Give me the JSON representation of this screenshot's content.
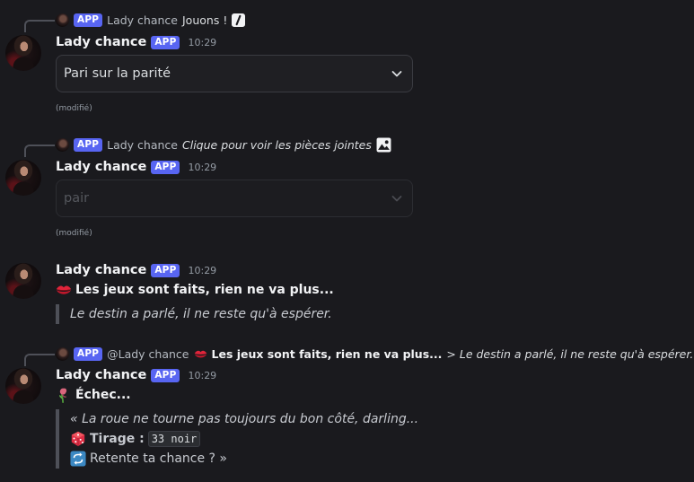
{
  "bot_name": "Lady chance",
  "app_badge": "APP",
  "messages": [
    {
      "reply": {
        "author": "Lady chance",
        "text": "Jouons !",
        "icon": "slash-command-icon"
      },
      "time": "10:29",
      "select": {
        "value": "Pari sur la parité",
        "disabled": false
      },
      "edited": "(modifié)"
    },
    {
      "reply": {
        "author": "Lady chance",
        "text": "Clique pour voir les pièces jointes",
        "icon": "image-icon"
      },
      "time": "10:29",
      "select": {
        "value": "pair",
        "disabled": true
      },
      "edited": "(modifié)"
    },
    {
      "time": "10:29",
      "title": "Les jeux sont faits, rien ne va plus...",
      "title_icon": "kiss-mark-icon",
      "quote": "Le destin a parlé, il ne reste qu'à espérer."
    },
    {
      "reply": {
        "author": "@Lady chance",
        "bold_text": "Les jeux sont faits, rien ne va plus...",
        "rest_text": "> Le destin a parlé, il ne reste qu'à espérer."
      },
      "time": "10:29",
      "title": "Échec...",
      "title_icon": "wilted-flower-icon",
      "quote_lines": {
        "line1": "« La roue ne tourne pas toujours du bon côté, darling...",
        "tirage_label": "Tirage :",
        "tirage_value": "33 noir",
        "line3": "Retente ta chance ? »"
      }
    }
  ]
}
